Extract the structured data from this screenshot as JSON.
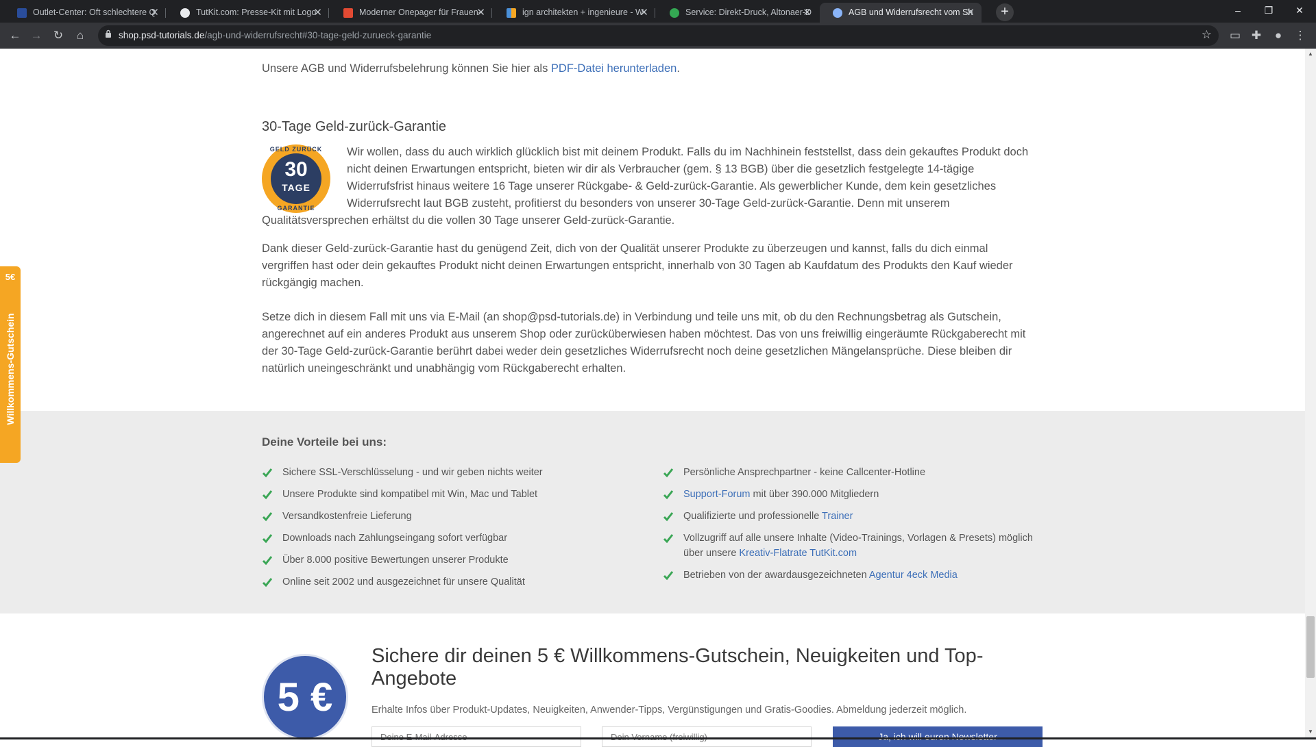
{
  "browser": {
    "tabs": [
      {
        "title": "Outlet-Center: Oft schlechtere Q",
        "favicon_color": "#2a4d9b"
      },
      {
        "title": "TutKit.com: Presse-Kit mit Logo",
        "favicon_color": "#e8eaed"
      },
      {
        "title": "Moderner Onepager für Frauen-",
        "favicon_color": "#e24a33"
      },
      {
        "title": "ign architekten + ingenieure - W",
        "favicon_color": "#4a90d9"
      },
      {
        "title": "Service: Direkt-Druck, Altonaer-D",
        "favicon_color": "#34a853"
      },
      {
        "title": "AGB und Widerrufsrecht vom Sh",
        "favicon_color": "#8ab4f8"
      }
    ],
    "url_host": "shop.psd-tutorials.de",
    "url_path": "/agb-und-widerrufsrecht#30-tage-geld-zurueck-garantie"
  },
  "content": {
    "download_text": "Unsere AGB und Widerrufsbelehrung können Sie hier als ",
    "download_link": "PDF-Datei herunterladen",
    "download_end": ".",
    "guarantee_heading": "30-Tage Geld-zurück-Garantie",
    "badge": {
      "ring_top": "GELD ZURÜCK",
      "number": "30",
      "unit": "TAGE",
      "ring_bottom": "GARANTIE"
    },
    "p1_lines": [
      "Wir wollen, dass du auch wirklich glücklich bist mit deinem Produkt. Falls du im Nachhinein feststellst, dass dein gekauftes Produkt doch",
      "nicht deinen Erwartungen entspricht, bieten wir dir als Verbraucher (gem. § 13 BGB) über die gesetzlich festgelegte 14-tägige",
      "Widerrufsfrist hinaus weitere 16 Tage unserer Rückgabe- & Geld-zurück-Garantie. Als gewerblicher Kunde, dem kein gesetzliches",
      "Widerrufsrecht laut BGB zusteht, profitierst du besonders von unserer 30-Tage Geld-zurück-Garantie. Denn mit unserem",
      "Qualitätsversprechen erhältst du die vollen 30 Tage unserer Geld-zurück-Garantie."
    ],
    "p2_lines": [
      "Dank dieser Geld-zurück-Garantie hast du genügend Zeit, dich von der Qualität unserer Produkte zu überzeugen und kannst, falls du dich einmal",
      "vergriffen hast oder dein gekauftes Produkt nicht deinen Erwartungen entspricht, innerhalb von 30 Tagen ab Kaufdatum des Produkts den Kauf wieder",
      "rückgängig machen."
    ],
    "p3_lines": [
      "Setze dich in diesem Fall mit uns via E-Mail (an shop@psd-tutorials.de) in Verbindung und teile uns mit, ob du den Rechnungsbetrag als Gutschein,",
      "angerechnet auf ein anderes Produkt aus unserem Shop oder zurücküberwiesen haben möchtest. Das von uns freiwillig eingeräumte Rückgaberecht mit",
      "der 30-Tage Geld-zurück-Garantie berührt dabei weder dein gesetzliches Widerrufsrecht noch deine gesetzlichen Mängelansprüche. Diese bleiben dir",
      "natürlich uneingeschränkt und unabhängig vom Rückgaberecht erhalten."
    ]
  },
  "vorteile": {
    "title": "Deine Vorteile bei uns:",
    "left": [
      {
        "text": "Sichere SSL-Verschlüsselung - und wir geben nichts weiter"
      },
      {
        "text": "Unsere Produkte sind kompatibel mit Win, Mac und Tablet"
      },
      {
        "text": "Versandkostenfreie Lieferung"
      },
      {
        "text": "Downloads nach Zahlungseingang sofort verfügbar"
      },
      {
        "text": "Über 8.000 positive Bewertungen unserer Produkte"
      },
      {
        "text": "Online seit 2002 und ausgezeichnet für unsere Qualität"
      }
    ],
    "right": [
      {
        "pre": "Persönliche Ansprechpartner - keine Callcenter-Hotline",
        "link": "",
        "post": ""
      },
      {
        "pre": "",
        "link": "Support-Forum",
        "post": " mit über 390.000 Mitgliedern"
      },
      {
        "pre": "Qualifizierte und professionelle ",
        "link": "Trainer",
        "post": ""
      },
      {
        "pre": "Vollzugriff auf alle unsere Inhalte (Video-Trainings, Vorlagen & Presets) möglich",
        "link": "",
        "post": ""
      },
      {
        "pre": "über unsere ",
        "link": "Kreativ-Flatrate TutKit.com",
        "post": ""
      },
      {
        "pre": "Betrieben von der awardausgezeichneten ",
        "link": "Agentur 4eck Media",
        "post": ""
      }
    ]
  },
  "newsletter": {
    "circle_text": "5 €",
    "title": "Sichere dir deinen 5 € Willkommens-Gutschein, Neuigkeiten und Top-Angebote",
    "subtitle": "Erhalte Infos über Produkt-Updates, Neuigkeiten, Anwender-Tipps, Vergünstigungen und Gratis-Goodies. Abmeldung jederzeit möglich.",
    "email_placeholder": "Deine E-Mail-Adresse",
    "name_placeholder": "Dein Vorname (freiwillig)",
    "button": "Ja, ich will euren Newsletter"
  },
  "side_tab": {
    "amount": "5€",
    "label": "Willkommens-Gutschein"
  },
  "colors": {
    "accent_orange": "#f5a623",
    "link_blue": "#3d6fb8",
    "check_green": "#3aa655",
    "brand_blue": "#3d5ba9"
  }
}
